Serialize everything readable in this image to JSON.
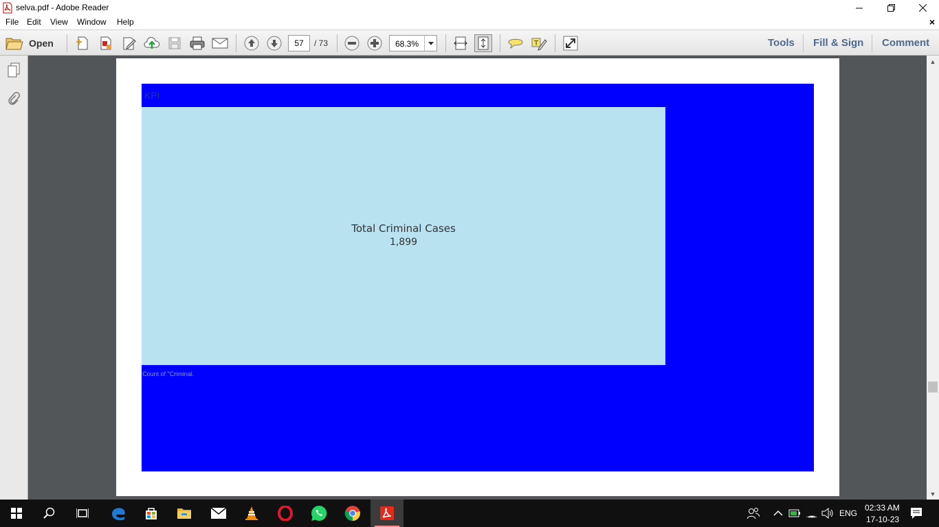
{
  "window": {
    "title": "selva.pdf - Adobe Reader"
  },
  "menu": {
    "file": "File",
    "edit": "Edit",
    "view": "View",
    "window": "Window",
    "help": "Help",
    "close_doc": "×"
  },
  "toolbar": {
    "open_label": "Open",
    "page_current": "57",
    "page_total": "/ 73",
    "zoom": "68.3%",
    "tools": "Tools",
    "fill_sign": "Fill & Sign",
    "comment": "Comment"
  },
  "dashboard": {
    "title": "KPI",
    "kpi_label": "Total Criminal Cases",
    "kpi_value": "1,899",
    "caption": "Count of \"Criminal."
  },
  "colors": {
    "dashboard_bg": "#0000ff",
    "tile_bg": "#b9e2f0",
    "doc_bg": "#525659"
  },
  "taskbar": {
    "time": "02:33 AM",
    "date": "17-10-23",
    "lang": "ENG"
  }
}
